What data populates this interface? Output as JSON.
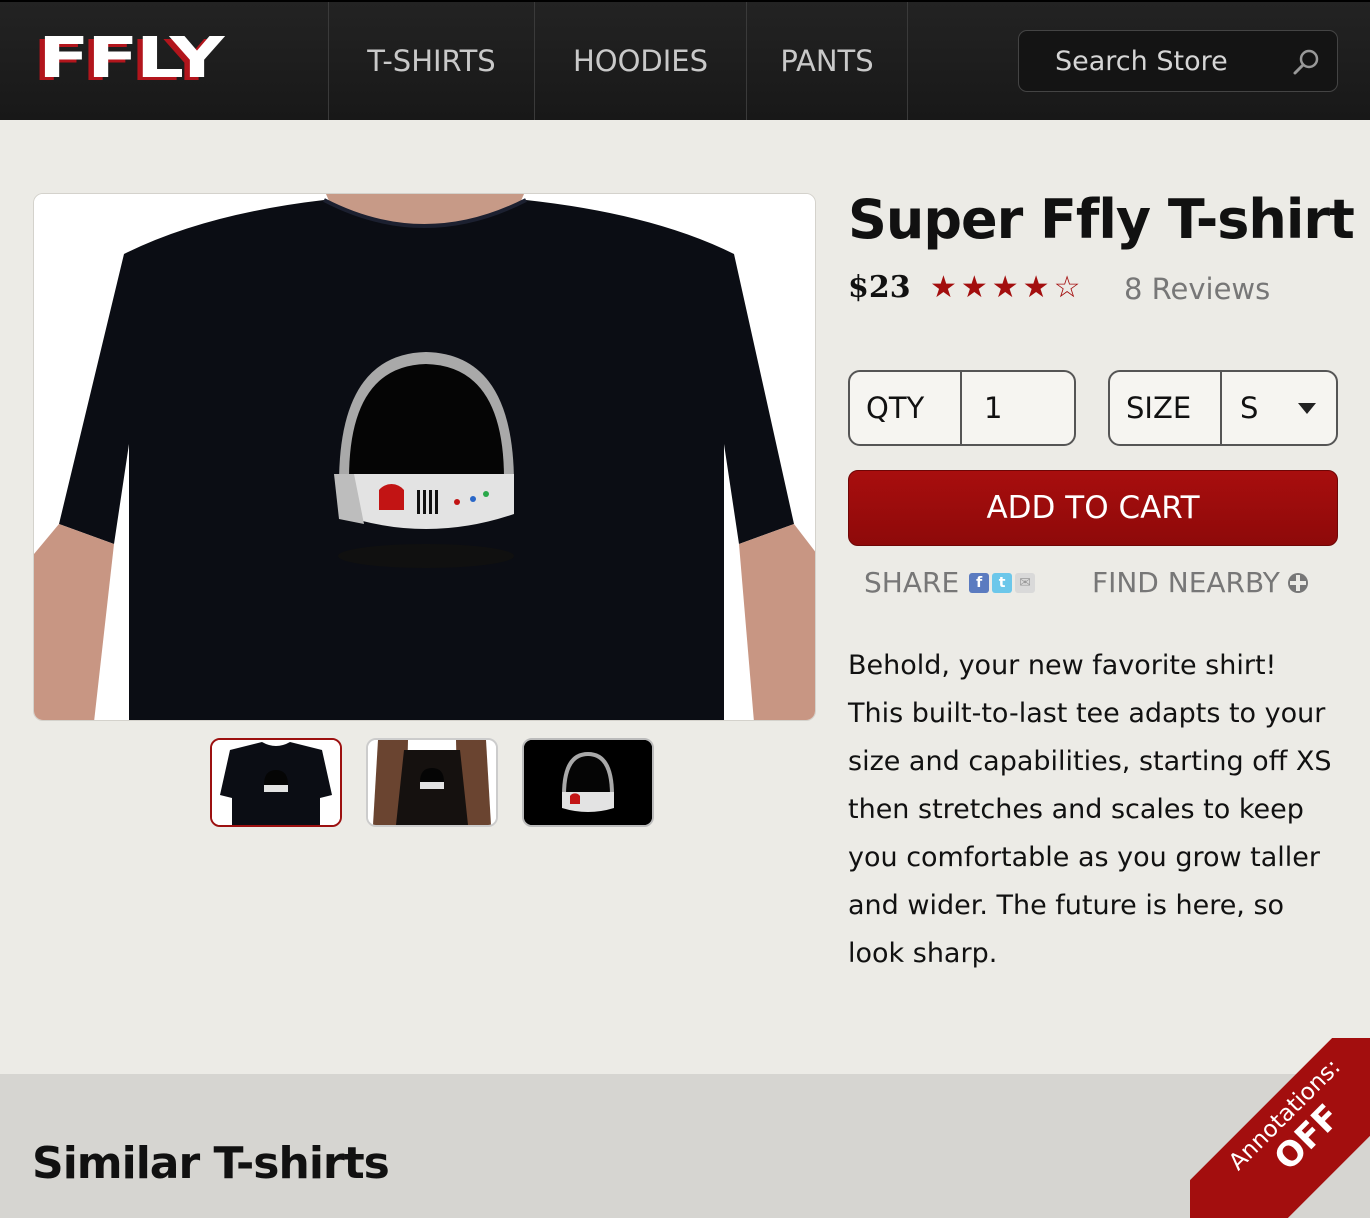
{
  "header": {
    "logo": "FFLY",
    "nav": [
      "T-SHIRTS",
      "HOODIES",
      "PANTS"
    ],
    "search_placeholder": "Search Store"
  },
  "product": {
    "title": "Super Ffly T-shirt",
    "price": "$23",
    "rating": 4,
    "rating_max": 5,
    "stars": "★★★★☆",
    "reviews": "8 Reviews",
    "qty_label": "QTY",
    "qty_value": "1",
    "size_label": "SIZE",
    "size_value": "S",
    "add_to_cart": "ADD TO CART",
    "share_label": "SHARE",
    "share_icons": [
      "facebook-icon",
      "twitter-icon",
      "email-icon"
    ],
    "find_nearby": "FIND NEARBY",
    "description": "Behold, your new favorite shirt! This built-to-last tee adapts to your size and capabilities, starting off XS then stretches and scales to keep you comfortable as you grow taller and wider. The future is here, so look sharp."
  },
  "similar": {
    "title": "Similar T-shirts"
  },
  "annotations": {
    "label": "Annotations:",
    "state": "OFF"
  },
  "colors": {
    "accent": "#a30e0e",
    "header_bg": "#1d1d1d",
    "page_bg": "#ecebe6"
  }
}
